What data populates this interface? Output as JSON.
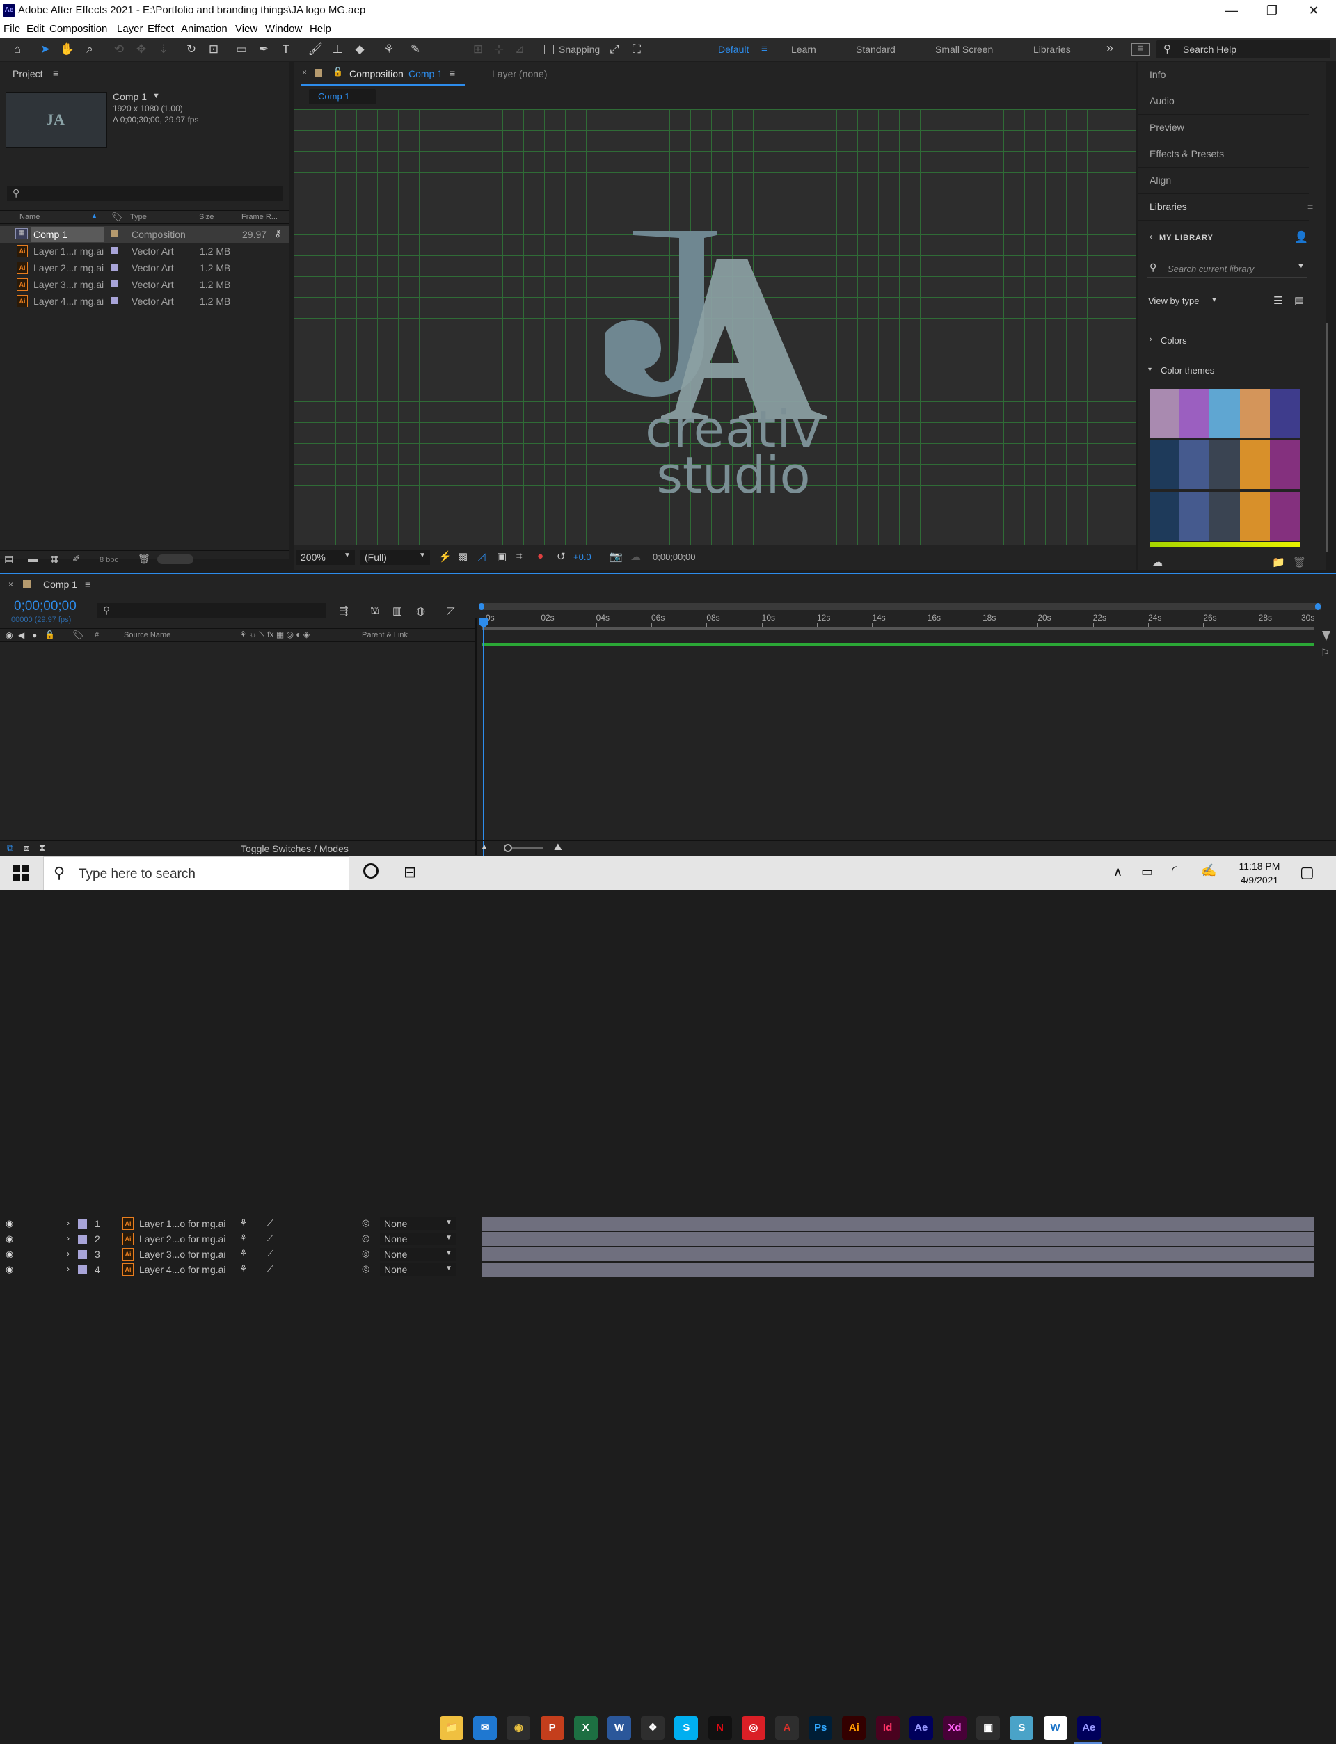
{
  "window": {
    "title": "Adobe After Effects 2021 - E:\\Portfolio and branding things\\JA logo MG.aep",
    "app_icon": "Ae",
    "minimize": "—",
    "restore": "❐",
    "close": "✕"
  },
  "menu": [
    "File",
    "Edit",
    "Composition",
    "Layer",
    "Effect",
    "Animation",
    "View",
    "Window",
    "Help"
  ],
  "toolbar": {
    "snapping_label": "Snapping",
    "workspaces": [
      "Default",
      "Learn",
      "Standard",
      "Small Screen",
      "Libraries"
    ],
    "active_workspace": "Default",
    "more": "»",
    "search_help": "Search Help"
  },
  "project": {
    "title": "Project",
    "comp_name": "Comp 1",
    "comp_dims": "1920 x 1080 (1.00)",
    "comp_duration": "Δ 0;00;30;00, 29.97 fps",
    "thumb_text": "JA",
    "columns": [
      "Name",
      "Type",
      "Size",
      "Frame R..."
    ],
    "items": [
      {
        "name": "Comp 1",
        "type": "Composition",
        "size": "",
        "fps": "29.97",
        "color": "#b59a6e",
        "kind": "comp"
      },
      {
        "name": "Layer 1...r mg.ai",
        "type": "Vector Art",
        "size": "1.2 MB",
        "fps": "",
        "color": "#a8a4d8",
        "kind": "ai"
      },
      {
        "name": "Layer 2...r mg.ai",
        "type": "Vector Art",
        "size": "1.2 MB",
        "fps": "",
        "color": "#a8a4d8",
        "kind": "ai"
      },
      {
        "name": "Layer 3...r mg.ai",
        "type": "Vector Art",
        "size": "1.2 MB",
        "fps": "",
        "color": "#a8a4d8",
        "kind": "ai"
      },
      {
        "name": "Layer 4...r mg.ai",
        "type": "Vector Art",
        "size": "1.2 MB",
        "fps": "",
        "color": "#a8a4d8",
        "kind": "ai"
      }
    ],
    "bpc": "8 bpc"
  },
  "composition": {
    "tab_prefix": "Composition",
    "tab_name": "Comp 1",
    "layer_tab": "Layer (none)",
    "flow_label": "Comp 1",
    "logo_j": "J",
    "logo_a": "A",
    "logo_line1": "creativ",
    "logo_line2": "studio",
    "zoom": "200%",
    "resolution": "(Full)",
    "exposure": "+0.0",
    "timecode": "0;00;00;00"
  },
  "right_panel": {
    "items": [
      "Info",
      "Audio",
      "Preview",
      "Effects & Presets",
      "Align",
      "Libraries"
    ],
    "my_library": "MY LIBRARY",
    "search_placeholder": "Search current library",
    "view_by": "View by type",
    "colors": "Colors",
    "color_themes": "Color themes",
    "themes": [
      [
        "#a98ab0",
        "#9b5fc0",
        "#5fa6d2",
        "#d4955a",
        "#3e3c8c"
      ],
      [
        "#1e3a5a",
        "#455a8e",
        "#3a4452",
        "#d8902a",
        "#84307e"
      ],
      [
        "#1e3a5a",
        "#455a8e",
        "#3a4452",
        "#d8902a",
        "#84307e"
      ]
    ]
  },
  "timeline": {
    "comp_tab": "Comp 1",
    "timecode": "0;00;00;00",
    "frame_info": "00000 (29.97 fps)",
    "col_num": "#",
    "col_source": "Source Name",
    "col_parent": "Parent & Link",
    "layers": [
      {
        "num": "1",
        "name": "Layer 1...o for mg.ai",
        "parent": "None"
      },
      {
        "num": "2",
        "name": "Layer 2...o for mg.ai",
        "parent": "None"
      },
      {
        "num": "3",
        "name": "Layer 3...o for mg.ai",
        "parent": "None"
      },
      {
        "num": "4",
        "name": "Layer 4...o for mg.ai",
        "parent": "None"
      }
    ],
    "ruler": [
      "0s",
      "02s",
      "04s",
      "06s",
      "08s",
      "10s",
      "12s",
      "14s",
      "16s",
      "18s",
      "20s",
      "22s",
      "24s",
      "26s",
      "28s",
      "30s"
    ],
    "toggle_label": "Toggle Switches / Modes"
  },
  "taskbar": {
    "search_placeholder": "Type here to search",
    "time": "11:18 PM",
    "date": "4/9/2021",
    "apps": [
      {
        "name": "file-explorer",
        "label": "📁",
        "bg": "#f0c040",
        "fg": "#6a4a00"
      },
      {
        "name": "mail",
        "label": "✉",
        "bg": "#1f78d1",
        "fg": "#ffffff"
      },
      {
        "name": "chrome",
        "label": "◉",
        "bg": "#2e2e2e",
        "fg": "#e8c040"
      },
      {
        "name": "powerpoint",
        "label": "P",
        "bg": "#c43e1c",
        "fg": "#ffffff"
      },
      {
        "name": "excel",
        "label": "X",
        "bg": "#1d6f42",
        "fg": "#ffffff"
      },
      {
        "name": "word",
        "label": "W",
        "bg": "#2b579a",
        "fg": "#ffffff"
      },
      {
        "name": "dropbox",
        "label": "❖",
        "bg": "#2e2e2e",
        "fg": "#ffffff"
      },
      {
        "name": "skype",
        "label": "S",
        "bg": "#00aff0",
        "fg": "#ffffff"
      },
      {
        "name": "netflix",
        "label": "N",
        "bg": "#111111",
        "fg": "#e50914"
      },
      {
        "name": "creative-cloud",
        "label": "◎",
        "bg": "#da1f26",
        "fg": "#ffffff"
      },
      {
        "name": "acrobat",
        "label": "A",
        "bg": "#2e2e2e",
        "fg": "#e0302a"
      },
      {
        "name": "photoshop",
        "label": "Ps",
        "bg": "#001e36",
        "fg": "#31a8ff"
      },
      {
        "name": "illustrator",
        "label": "Ai",
        "bg": "#330000",
        "fg": "#ff9a00"
      },
      {
        "name": "indesign",
        "label": "Id",
        "bg": "#49021f",
        "fg": "#ff3366"
      },
      {
        "name": "after-effects-2",
        "label": "Ae",
        "bg": "#00005b",
        "fg": "#9999ff"
      },
      {
        "name": "xd",
        "label": "Xd",
        "bg": "#470137",
        "fg": "#ff61f6"
      },
      {
        "name": "store",
        "label": "▣",
        "bg": "#2e2e2e",
        "fg": "#ffffff"
      },
      {
        "name": "simplenote",
        "label": "S",
        "bg": "#4aa3c8",
        "fg": "#ffffff"
      },
      {
        "name": "wordweb",
        "label": "W",
        "bg": "#ffffff",
        "fg": "#1a73c8"
      },
      {
        "name": "after-effects",
        "label": "Ae",
        "bg": "#00005b",
        "fg": "#9999ff"
      }
    ]
  }
}
